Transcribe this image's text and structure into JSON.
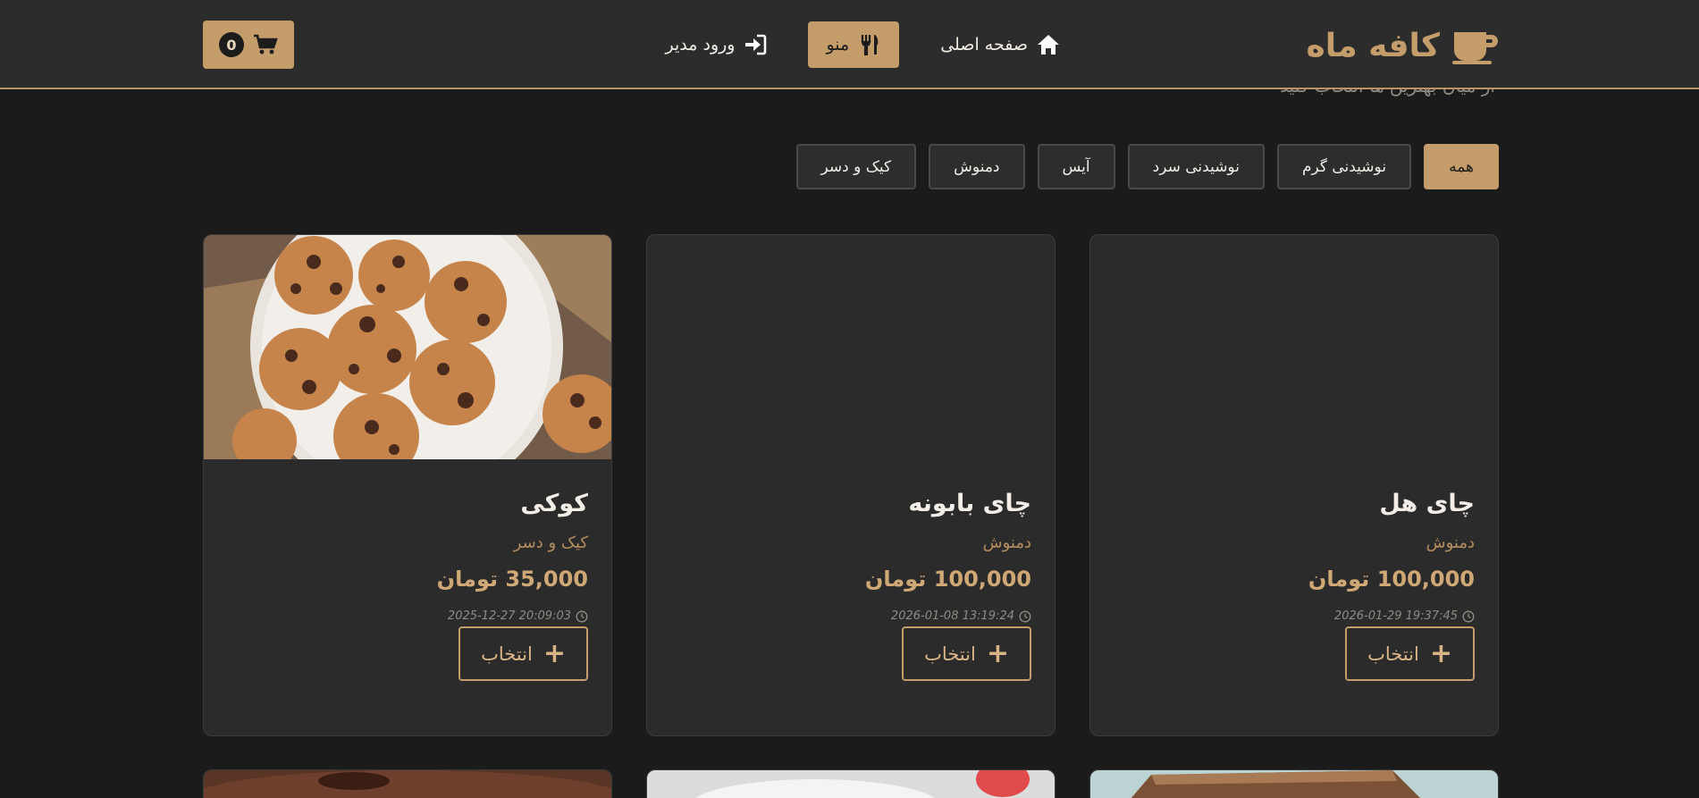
{
  "navbar": {
    "brand": "کافه ماه",
    "links": [
      {
        "label": "صفحه اصلی",
        "icon": "home-icon"
      },
      {
        "label": "منو",
        "icon": "utensils-icon",
        "active": true
      },
      {
        "label": "ورود مدیر",
        "icon": "sign-in-icon"
      }
    ],
    "cart_count": "0"
  },
  "hidden_subtitle": "از میان بهترین ها انتخاب کنید",
  "filters": [
    {
      "label": "همه",
      "active": true
    },
    {
      "label": "نوشیدنی گرم"
    },
    {
      "label": "نوشیدنی سرد"
    },
    {
      "label": "آیس"
    },
    {
      "label": "دمنوش"
    },
    {
      "label": "کیک و دسر"
    }
  ],
  "products": [
    {
      "title": "چای هل",
      "category": "دمنوش",
      "price": "100,000 تومان",
      "date": "2026-01-29 19:37:45",
      "button": "انتخاب",
      "image": "none"
    },
    {
      "title": "چای بابونه",
      "category": "دمنوش",
      "price": "100,000 تومان",
      "date": "2026-01-08 13:19:24",
      "button": "انتخاب",
      "image": "none"
    },
    {
      "title": "کوکی",
      "category": "کیک و دسر",
      "price": "35,000 تومان",
      "date": "2025-12-27 20:09:03",
      "button": "انتخاب",
      "image": "cookies-photo"
    }
  ],
  "colors": {
    "accent": "#c59d6a",
    "background": "#1b1b1b",
    "card": "#2b2b2b"
  }
}
